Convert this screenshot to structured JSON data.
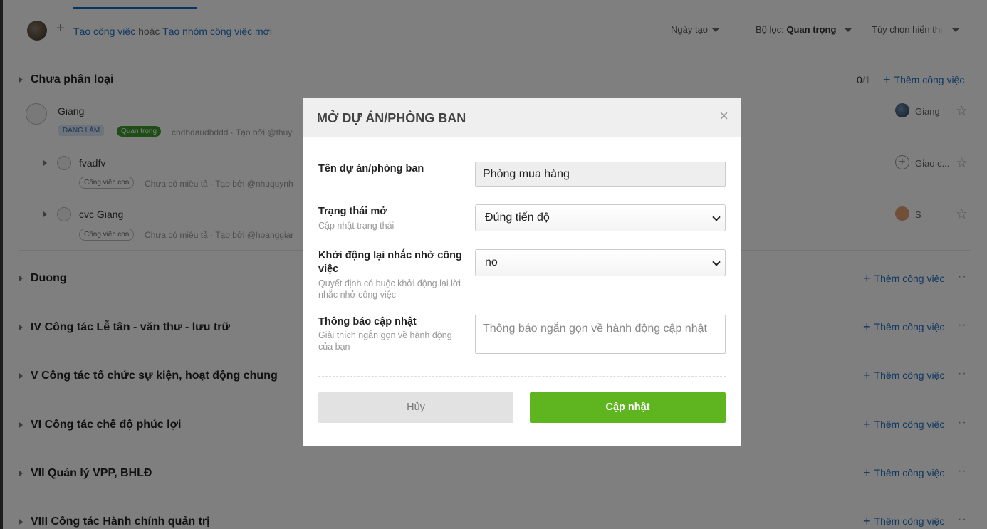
{
  "toolbar": {
    "create_task": "Tạo công việc",
    "or_text": "hoặc",
    "create_group": "Tạo nhóm công việc mới",
    "sort_label": "Ngày tạo",
    "filter_prefix": "Bộ lọc:",
    "filter_value": "Quan trọng",
    "display_options": "Tùy chọn hiển thị"
  },
  "groups": [
    {
      "title": "Chưa phân loại",
      "count_done": "0",
      "count_total": "/1",
      "add_label": "Thêm công việc"
    },
    {
      "title": "Duong",
      "add_label": "Thêm công việc"
    },
    {
      "title": "IV Công tác Lễ tân - văn thư - lưu trữ",
      "add_label": "Thêm công việc"
    },
    {
      "title": "V Công tác tổ chức sự kiện, hoạt động chung",
      "add_label": "Thêm công việc"
    },
    {
      "title": "VI Công tác chế độ phúc lợi",
      "add_label": "Thêm công việc"
    },
    {
      "title": "VII Quản lý VPP, BHLĐ",
      "add_label": "Thêm công việc"
    },
    {
      "title": "VIII Công tác Hành chính quản trị",
      "add_label": "Thêm công việc"
    }
  ],
  "tasks": [
    {
      "name": "Giang",
      "badge_status": "ĐANG LÀM",
      "badge_priority": "Quan trọng",
      "meta": "cndhdaudbddd · Tạo bởi @thuy",
      "assignee": "Giang"
    },
    {
      "name": "fvadfv",
      "badge": "Công việc con",
      "meta": "Chưa có miêu tả · Tạo bởi @nhuquynh",
      "assignee": "Giao c..."
    },
    {
      "name": "cvc Giang",
      "badge": "Công việc con",
      "meta": "Chưa có miêu tả · Tạo bởi @hoanggiar",
      "assignee": "S"
    }
  ],
  "modal": {
    "title": "MỞ DỰ ÁN/PHÒNG BAN",
    "close_symbol": "×",
    "name_label": "Tên dự án/phòng ban",
    "name_value": "Phòng mua hàng",
    "status_label": "Trạng thái mở",
    "status_sub": "Cập nhật trạng thái",
    "status_value": "Đúng tiến độ",
    "reminder_label": "Khởi động lại nhắc nhở công việc",
    "reminder_sub": "Quyết định có buộc khởi động lại lời nhắc nhở công việc",
    "reminder_value": "no",
    "notify_label": "Thông báo cập nhật",
    "notify_sub": "Giải thích ngắn gọn về hành động của bạn",
    "notify_placeholder": "Thông báo ngắn gọn về hành động cập nhật",
    "cancel_label": "Hủy",
    "submit_label": "Cập nhật"
  },
  "colors": {
    "primary_link": "#1e6fc0",
    "submit_green": "#5fb51f",
    "priority_green": "#3f9a2c"
  }
}
